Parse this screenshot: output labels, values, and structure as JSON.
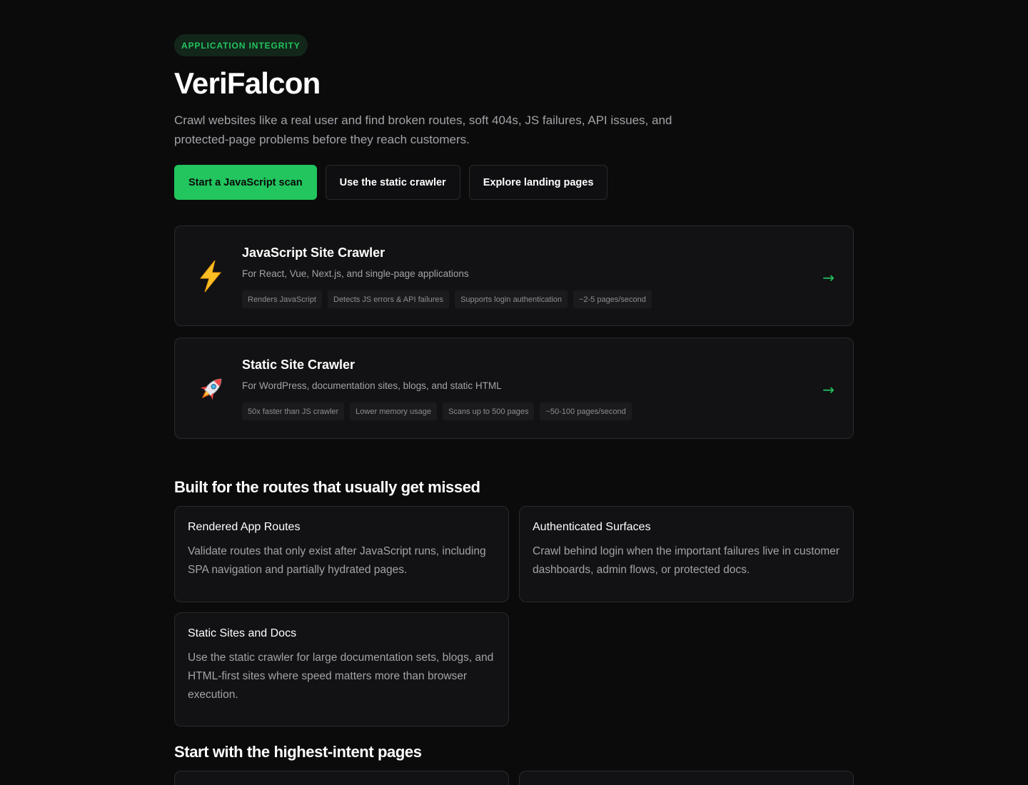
{
  "hero": {
    "badge": "APPLICATION INTEGRITY",
    "title": "VeriFalcon",
    "subtitle": "Crawl websites like a real user and find broken routes, soft 404s, JS failures, API issues, and protected-page problems before they reach customers.",
    "actions": [
      {
        "label": "Start a JavaScript scan"
      },
      {
        "label": "Use the static crawler"
      },
      {
        "label": "Explore landing pages"
      }
    ]
  },
  "crawlers": [
    {
      "icon": "lightning-icon",
      "title": "JavaScript Site Crawler",
      "description": "For React, Vue, Next.js, and single-page applications",
      "tags": [
        "Renders JavaScript",
        "Detects JS errors & API failures",
        "Supports login authentication",
        "~2-5 pages/second"
      ],
      "arrow": "→"
    },
    {
      "icon": "rocket-icon",
      "title": "Static Site Crawler",
      "description": "For WordPress, documentation sites, blogs, and static HTML",
      "tags": [
        "50x faster than JS crawler",
        "Lower memory usage",
        "Scans up to 500 pages",
        "~50-100 pages/second"
      ],
      "arrow": "→"
    }
  ],
  "routes_section": {
    "title": "Built for the routes that usually get missed",
    "features": [
      {
        "title": "Rendered App Routes",
        "description": "Validate routes that only exist after JavaScript runs, including SPA navigation and partially hydrated pages."
      },
      {
        "title": "Authenticated Surfaces",
        "description": "Crawl behind login when the important failures live in customer dashboards, admin flows, or protected docs."
      },
      {
        "title": "Static Sites and Docs",
        "description": "Use the static crawler for large documentation sets, blogs, and HTML-first sites where speed matters more than browser execution."
      }
    ]
  },
  "intent_section": {
    "title": "Start with the highest-intent pages"
  },
  "colors": {
    "accent": "#22c55e",
    "background": "#0b0b0c",
    "card": "#121214",
    "border": "#2a2a2e"
  }
}
